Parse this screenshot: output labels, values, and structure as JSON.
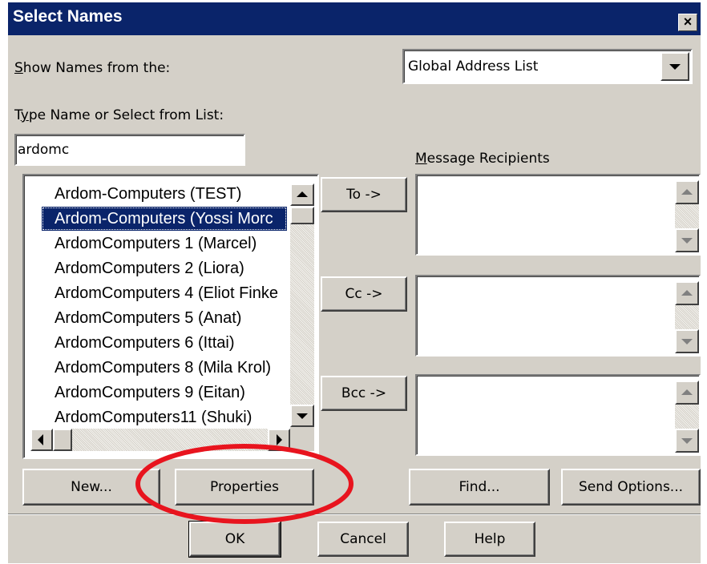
{
  "window": {
    "title": "Select Names",
    "close_label": "×"
  },
  "show_names": {
    "label": "Show Names from the:",
    "selected": "Global Address List"
  },
  "search": {
    "label": "Type Name or Select from List:",
    "value": "ardomc"
  },
  "recipients": {
    "label": "Message Recipients"
  },
  "names_list": {
    "items": [
      "Ardom-Computers (TEST)",
      "Ardom-Computers (Yossi Morc",
      "ArdomComputers 1 (Marcel)",
      "ArdomComputers 2 (Liora)",
      "ArdomComputers 4 (Eliot Finke",
      "ArdomComputers 5 (Anat)",
      "ArdomComputers 6 (Ittai)",
      "ArdomComputers 8 (Mila  Krol)",
      "ArdomComputers 9 (Eitan)",
      "ArdomComputers11 (Shuki)"
    ],
    "selected_index": 1
  },
  "buttons": {
    "to": "To ->",
    "cc": "Cc ->",
    "bcc": "Bcc ->",
    "new": "New...",
    "properties": "Properties",
    "find": "Find...",
    "send_options": "Send Options...",
    "ok": "OK",
    "cancel": "Cancel",
    "help": "Help"
  },
  "annotation": {
    "color": "#e8141e",
    "target": "Properties"
  }
}
